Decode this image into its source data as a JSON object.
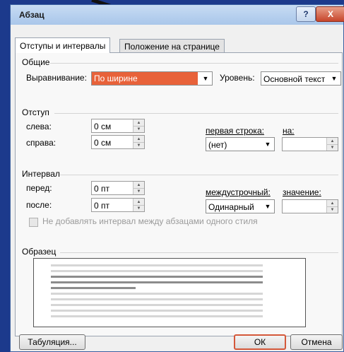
{
  "window": {
    "title": "Абзац",
    "help_label": "?",
    "close_label": "X"
  },
  "tabs": [
    {
      "label": "Отступы и интервалы",
      "mnemonic": "и",
      "active": true
    },
    {
      "label": "Положение на странице",
      "mnemonic": "ж",
      "active": false
    }
  ],
  "general": {
    "section_label": "Общие",
    "alignment_label": "Выравнивание:",
    "alignment_value": "По ширине",
    "level_label": "Уровень:",
    "level_value": "Основной текст"
  },
  "indent": {
    "section_label": "Отступ",
    "left_label": "слева:",
    "left_value": "0 см",
    "right_label": "справа:",
    "right_value": "0 см",
    "first_line_label": "первая строка:",
    "first_line_value": "(нет)",
    "by_label": "на:",
    "by_value": ""
  },
  "spacing": {
    "section_label": "Интервал",
    "before_label": "перед:",
    "before_value": "0 пт",
    "after_label": "после:",
    "after_value": "0 пт",
    "line_spacing_label": "междустрочный:",
    "line_spacing_value": "Одинарный",
    "at_label": "значение:",
    "at_value": "",
    "no_space_checkbox_label": "Не добавлять интервал между абзацами одного стиля",
    "no_space_checked": false
  },
  "preview": {
    "section_label": "Образец"
  },
  "buttons": {
    "tabs_label": "Табуляция...",
    "ok_label": "ОК",
    "cancel_label": "Отмена"
  },
  "colors": {
    "selection": "#e8623a",
    "ok_border": "#d4583a",
    "desktop": "#1c3a8c"
  }
}
